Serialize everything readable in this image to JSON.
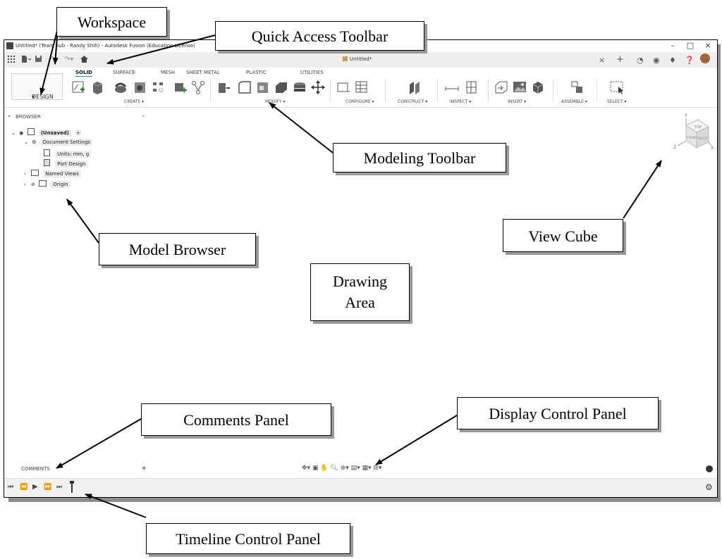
{
  "window": {
    "title": "Untitled* (Team hub - Randy Shih) - Autodesk Fusion (Education License)",
    "controls": {
      "minimize": "–",
      "maximize": "□",
      "close": "×"
    }
  },
  "quick_access": {
    "grid_icon": "grid-icon",
    "file_icon": "file-icon",
    "save_icon": "save-icon",
    "undo_icon": "undo-icon",
    "redo_icon": "redo-icon",
    "home_icon": "home-icon"
  },
  "document_tab": {
    "label": "Untitled*",
    "close": "×",
    "new": "+"
  },
  "ribbon": {
    "workspace_label": "DESIGN",
    "tabs": [
      "SOLID",
      "SURFACE",
      "MESH",
      "SHEET METAL",
      "PLASTIC",
      "UTILITIES"
    ],
    "active_tab": "SOLID",
    "groups": {
      "create": "CREATE ▾",
      "modify": "MODIFY ▾",
      "configure": "CONFIGURE ▾",
      "construct": "CONSTRUCT ▾",
      "inspect": "INSPECT ▾",
      "insert": "INSERT ▾",
      "assemble": "ASSEMBLE ▾",
      "select": "SELECT ▾"
    }
  },
  "browser": {
    "title": "BROWSER",
    "collapse": "–",
    "items": [
      {
        "label": "(Unsaved)"
      },
      {
        "label": "Document Settings"
      },
      {
        "label": "Units: mm, g"
      },
      {
        "label": "Part Design"
      },
      {
        "label": "Named Views"
      },
      {
        "label": "Origin"
      }
    ]
  },
  "comments": {
    "label": "COMMENTS",
    "add": "+"
  },
  "viewcube": {
    "top": "TOP",
    "front": "FRONT",
    "right": "RIGHT",
    "axis_x": "X",
    "axis_y": "Y",
    "axis_z": "Z"
  },
  "callouts": {
    "workspace": "Workspace",
    "quick_access": "Quick Access Toolbar",
    "modeling_toolbar": "Modeling Toolbar",
    "view_cube": "View Cube",
    "model_browser": "Model Browser",
    "drawing_area_1": "Drawing",
    "drawing_area_2": "Area",
    "comments_panel": "Comments Panel",
    "display_control": "Display Control Panel",
    "timeline_control": "Timeline Control Panel"
  },
  "colors": {
    "accent": "#0696d7",
    "toolbar_bg": "#eeeeee",
    "callout_shadow": "#999999"
  }
}
